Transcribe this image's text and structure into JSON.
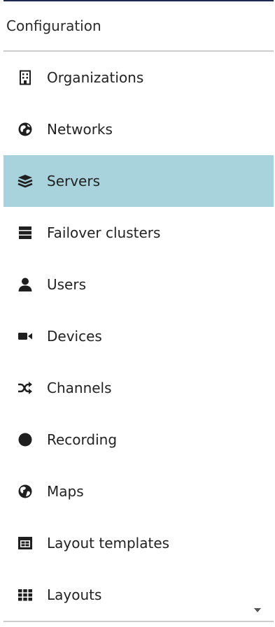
{
  "panel": {
    "header": "Configuration",
    "items": [
      {
        "label": "Organizations",
        "icon": "building-icon"
      },
      {
        "label": "Networks",
        "icon": "globe-network-icon"
      },
      {
        "label": "Servers",
        "icon": "server-stack-icon",
        "selected": true
      },
      {
        "label": "Failover clusters",
        "icon": "cluster-icon"
      },
      {
        "label": "Users",
        "icon": "user-icon"
      },
      {
        "label": "Devices",
        "icon": "video-camera-icon"
      },
      {
        "label": "Channels",
        "icon": "shuffle-icon"
      },
      {
        "label": "Recording",
        "icon": "record-icon"
      },
      {
        "label": "Maps",
        "icon": "globe-icon"
      },
      {
        "label": "Layout templates",
        "icon": "layout-template-icon"
      },
      {
        "label": "Layouts",
        "icon": "grid-icon"
      }
    ]
  },
  "colors": {
    "selected_background": "#a8d2dc",
    "top_rule": "#1b2a4e",
    "divider": "#cccccc"
  }
}
